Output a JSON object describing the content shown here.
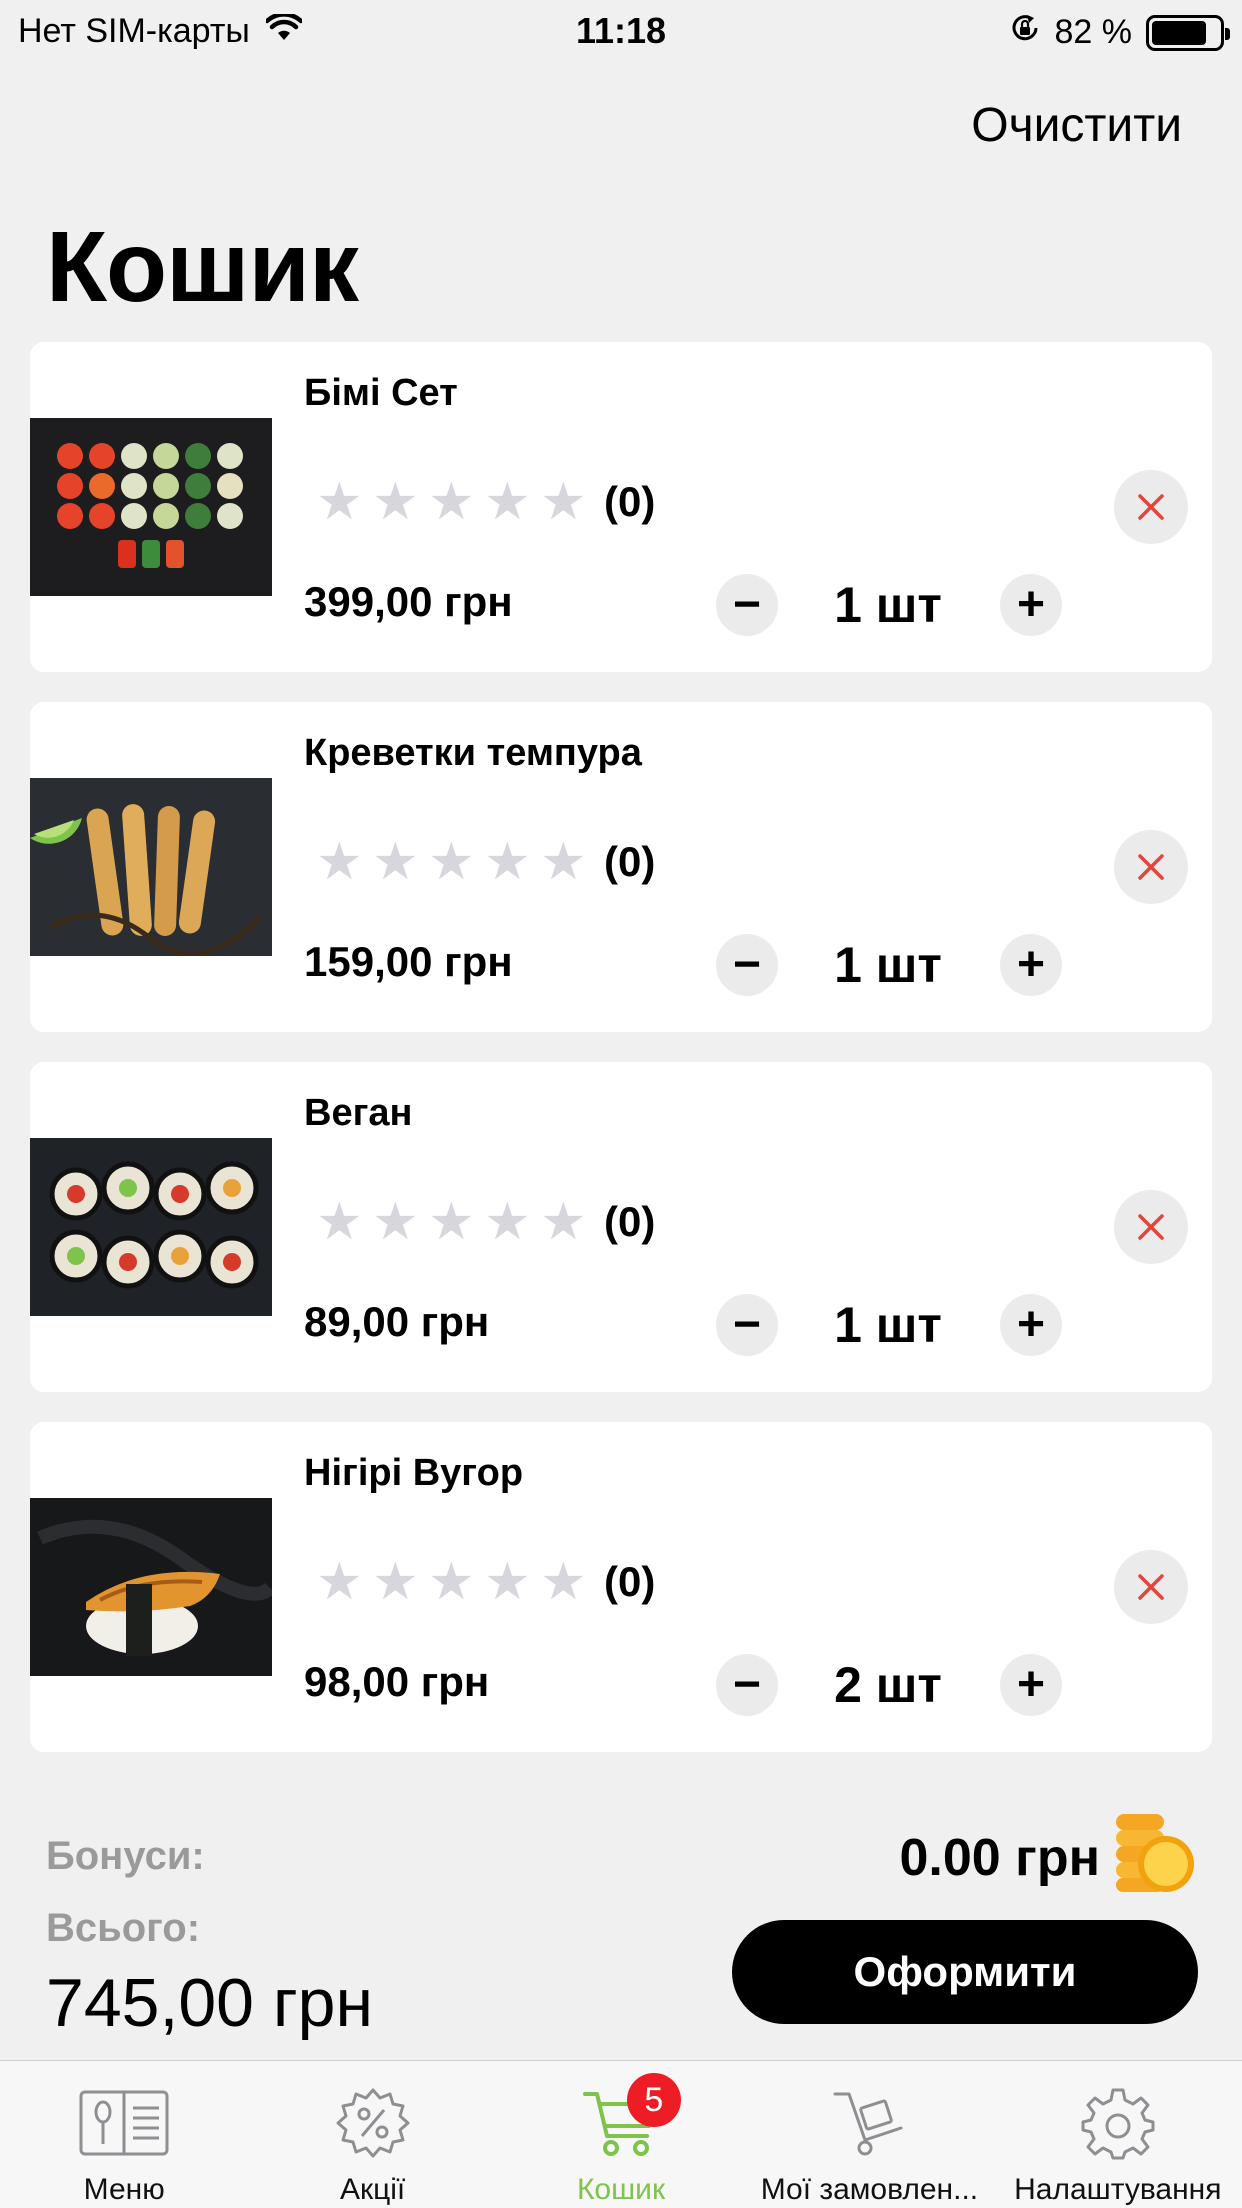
{
  "status_bar": {
    "carrier": "Нет SIM-карты",
    "time": "11:18",
    "battery": "82 %",
    "battery_level": 0.82
  },
  "header": {
    "clear_label": "Очистити",
    "title": "Кошик"
  },
  "cart": {
    "items": [
      {
        "name": "Бімі Сет",
        "rating_count": "(0)",
        "rating": 0,
        "price": "399,00 грн",
        "quantity": "1 шт",
        "image": "sushi-set"
      },
      {
        "name": "Креветки темпура",
        "rating_count": "(0)",
        "rating": 0,
        "price": "159,00 грн",
        "quantity": "1 шт",
        "image": "tempura-shrimp"
      },
      {
        "name": "Веган",
        "rating_count": "(0)",
        "rating": 0,
        "price": "89,00 грн",
        "quantity": "1 шт",
        "image": "vegan-rolls"
      },
      {
        "name": "Нігірі Вугор",
        "rating_count": "(0)",
        "rating": 0,
        "price": "98,00 грн",
        "quantity": "2 шт",
        "image": "eel-nigiri"
      }
    ],
    "minus_symbol": "−",
    "plus_symbol": "+"
  },
  "summary": {
    "bonus_label": "Бонуси:",
    "bonus_value": "0.00 грн",
    "total_label": "Всього:",
    "total_value": "745,00 грн",
    "checkout_label": "Оформити"
  },
  "tab_bar": {
    "tabs": [
      {
        "label": "Меню",
        "icon": "menu-book-icon"
      },
      {
        "label": "Акції",
        "icon": "discount-gear-icon"
      },
      {
        "label": "Кошик",
        "icon": "cart-icon",
        "badge": "5",
        "active": true
      },
      {
        "label": "Мої замовлен...",
        "icon": "delivery-cart-icon"
      },
      {
        "label": "Налаштування",
        "icon": "settings-icon"
      }
    ]
  },
  "colors": {
    "accent": "#7ec34a",
    "badge": "#ee1c24",
    "remove": "#e2453c",
    "background": "#f0f0f0"
  }
}
